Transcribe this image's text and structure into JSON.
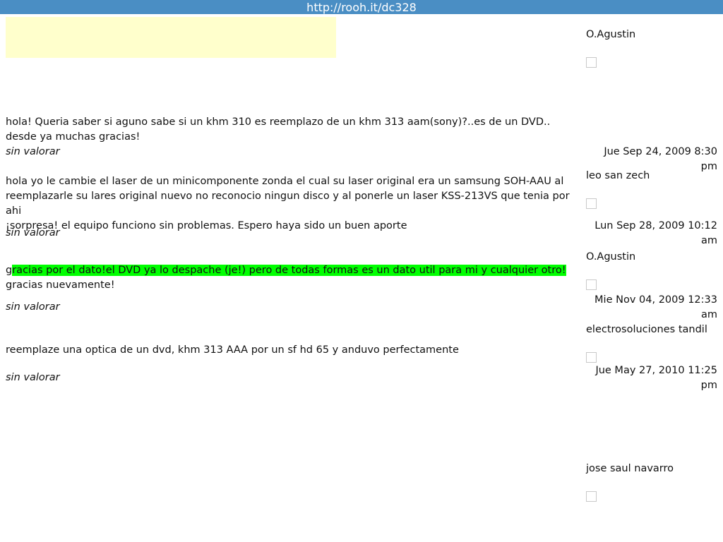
{
  "header": {
    "url": "http://rooh.it/dc328"
  },
  "posts": [
    {
      "text_lines": [
        "hola! Queria saber si aguno sabe si un khm 310 es reemplazo de un khm 313 aam(sony)?..es de un DVD..",
        "desde ya muchas gracias!"
      ],
      "rating": "sin valorar"
    },
    {
      "text_lines": [
        "hola yo le cambie el laser de un minicomponente zonda el cual su laser original era un samsung SOH-AAU al",
        "reemplazarle su lares original nuevo no reconocio ningun disco y al ponerle un laser KSS-213VS que tenia por ahi",
        "¡sorpresa! el equipo funciono sin problemas. Espero haya sido un buen aporte"
      ],
      "rating": "sin valorar"
    },
    {
      "text_lead": "g",
      "text_highlight": "racias por el dato!el DVD ya lo despache (je!) pero de todas formas es un dato util para mi y cualquier otro!",
      "text_line2": "gracias nuevamente!",
      "rating": "sin valorar"
    },
    {
      "text_lines": [
        "reemplaze una optica de un dvd, khm 313 AAA por un sf hd 65 y anduvo perfectamente"
      ],
      "rating": "sin valorar"
    }
  ],
  "sidebar": {
    "authors": [
      "O.Agustin",
      "leo san zech",
      "O.Agustin",
      "electrosoluciones tandil",
      "jose saul navarro"
    ],
    "dates": [
      [
        "Jue Sep 24, 2009 8:30 pm"
      ],
      [
        "Lun Sep 28, 2009 10:12",
        "am"
      ],
      [
        "Mie Nov 04, 2009 12:33",
        "am"
      ],
      [
        "Jue May 27, 2010 11:25",
        "pm"
      ]
    ]
  }
}
